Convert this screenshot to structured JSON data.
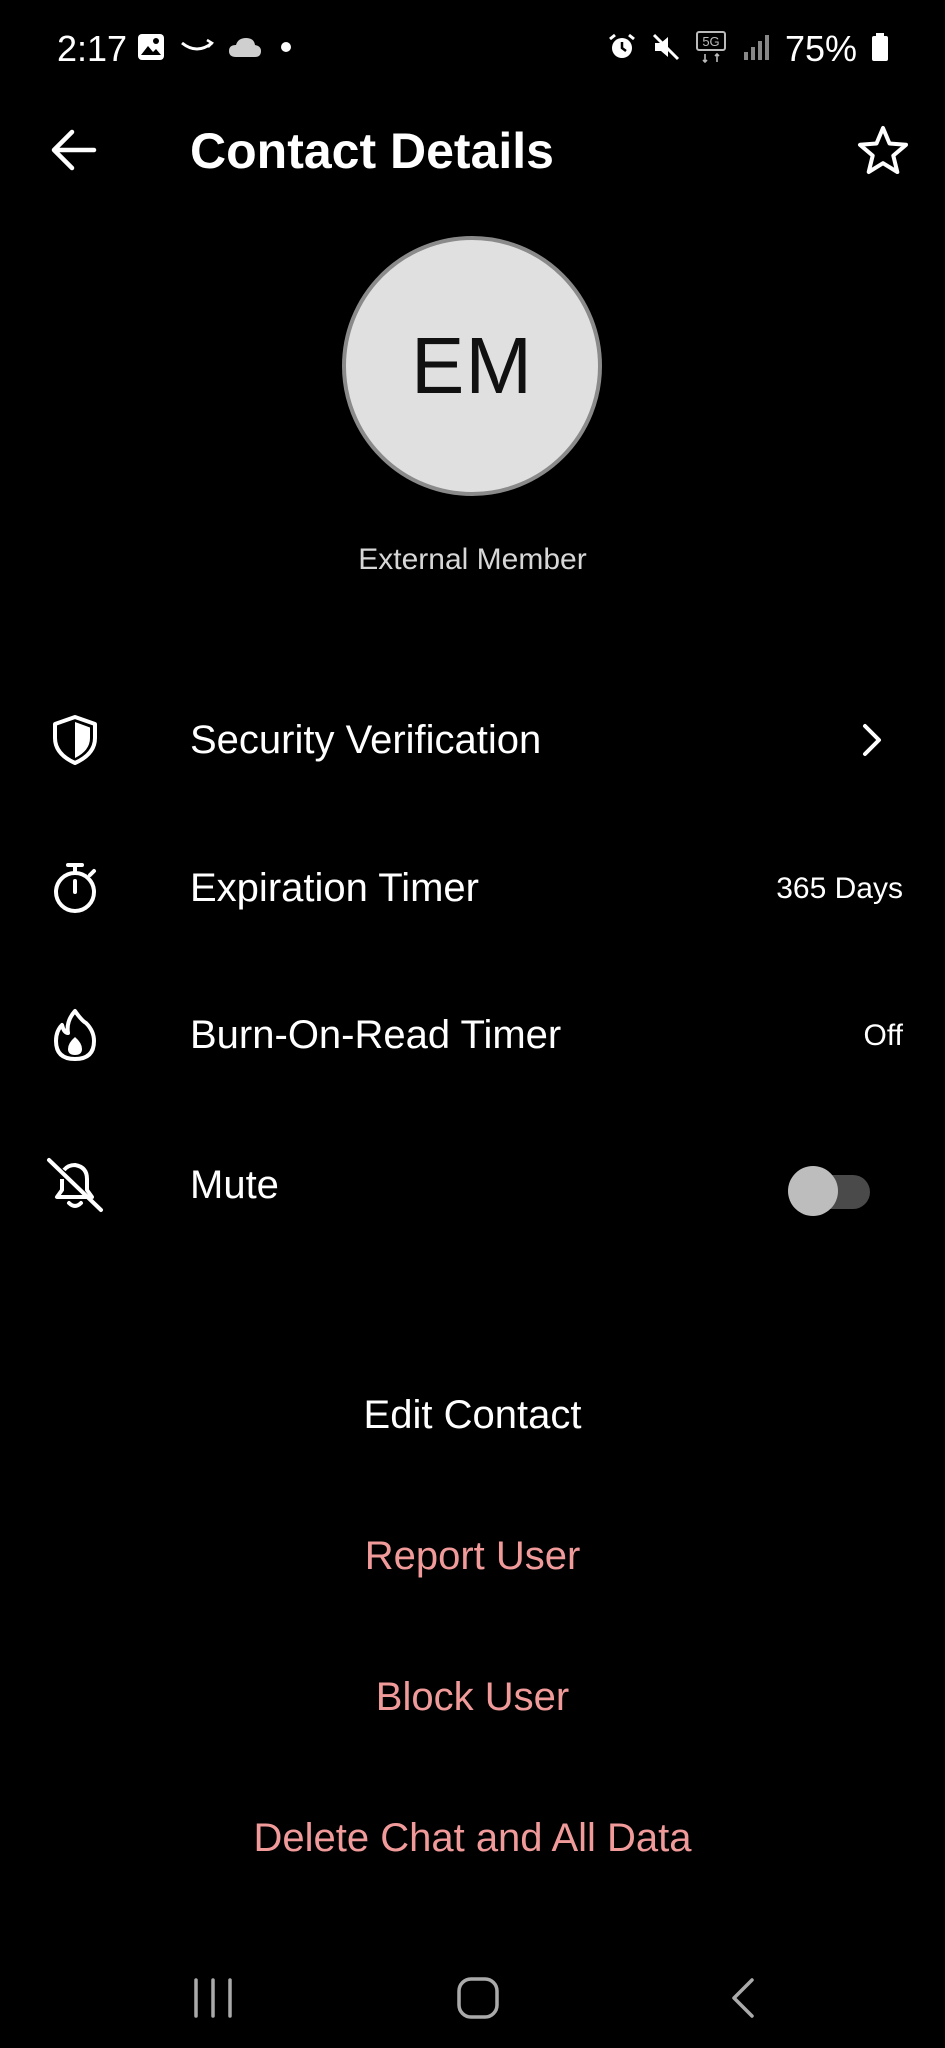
{
  "status_bar": {
    "time": "2:17",
    "battery": "75%",
    "left_icons": [
      "image-icon",
      "amazon-smile-icon",
      "cloud-icon",
      "dot-icon"
    ],
    "right_icons": [
      "alarm-icon",
      "mute-icon",
      "5g-icon",
      "signal-icon",
      "battery-icon"
    ]
  },
  "header": {
    "title": "Contact Details",
    "back_icon": "arrow-left-icon",
    "favorite_icon": "star-outline-icon"
  },
  "contact": {
    "initials": "EM",
    "subtitle": "External Member"
  },
  "settings": {
    "security": {
      "label": "Security Verification",
      "icon": "shield-icon"
    },
    "expiration": {
      "label": "Expiration Timer",
      "value": "365 Days",
      "icon": "stopwatch-icon"
    },
    "burn": {
      "label": "Burn-On-Read Timer",
      "value": "Off",
      "icon": "flame-icon"
    },
    "mute": {
      "label": "Mute",
      "icon": "bell-off-icon",
      "enabled": false
    }
  },
  "actions": {
    "edit": "Edit Contact",
    "report": "Report User",
    "block": "Block User",
    "delete": "Delete Chat and All Data"
  },
  "colors": {
    "background": "#000000",
    "danger": "#f19a9a",
    "avatar_bg": "#e0e0e0"
  }
}
